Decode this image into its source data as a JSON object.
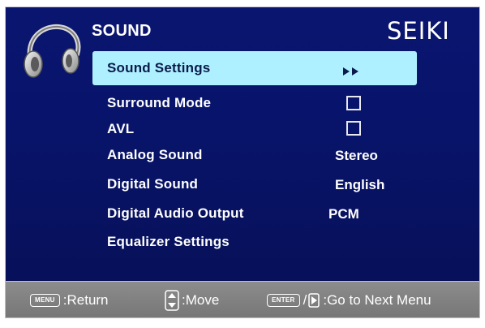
{
  "header": {
    "title": "SOUND",
    "brand": "SEIKI"
  },
  "menu": {
    "items": [
      {
        "label": "Sound Settings",
        "value": "",
        "control": "submenu-arrow"
      },
      {
        "label": "Surround Mode",
        "value": "",
        "control": "checkbox",
        "checked": false
      },
      {
        "label": "AVL",
        "value": "",
        "control": "checkbox",
        "checked": false
      },
      {
        "label": "Analog Sound",
        "value": "Stereo",
        "control": "value"
      },
      {
        "label": "Digital Sound",
        "value": "English",
        "control": "value"
      },
      {
        "label": "Digital Audio Output",
        "value": "PCM",
        "control": "value"
      },
      {
        "label": "Equalizer Settings",
        "value": "",
        "control": "none"
      }
    ],
    "selected_index": 0
  },
  "footer": {
    "menu_key": "MENU",
    "return_label": ":Return",
    "move_label": ":Move",
    "enter_key": "ENTER",
    "separator": "/",
    "next_label": ":Go to Next Menu"
  },
  "icons": {
    "header_icon": "headphones-icon",
    "submenu": "double-right-arrow-icon",
    "move": "up-down-arrow-icon",
    "next": "right-arrow-icon"
  },
  "colors": {
    "panel_background": "#08146a",
    "selection_highlight": "#aef0ff",
    "footer_background": "#808080",
    "text": "#ffffff"
  }
}
